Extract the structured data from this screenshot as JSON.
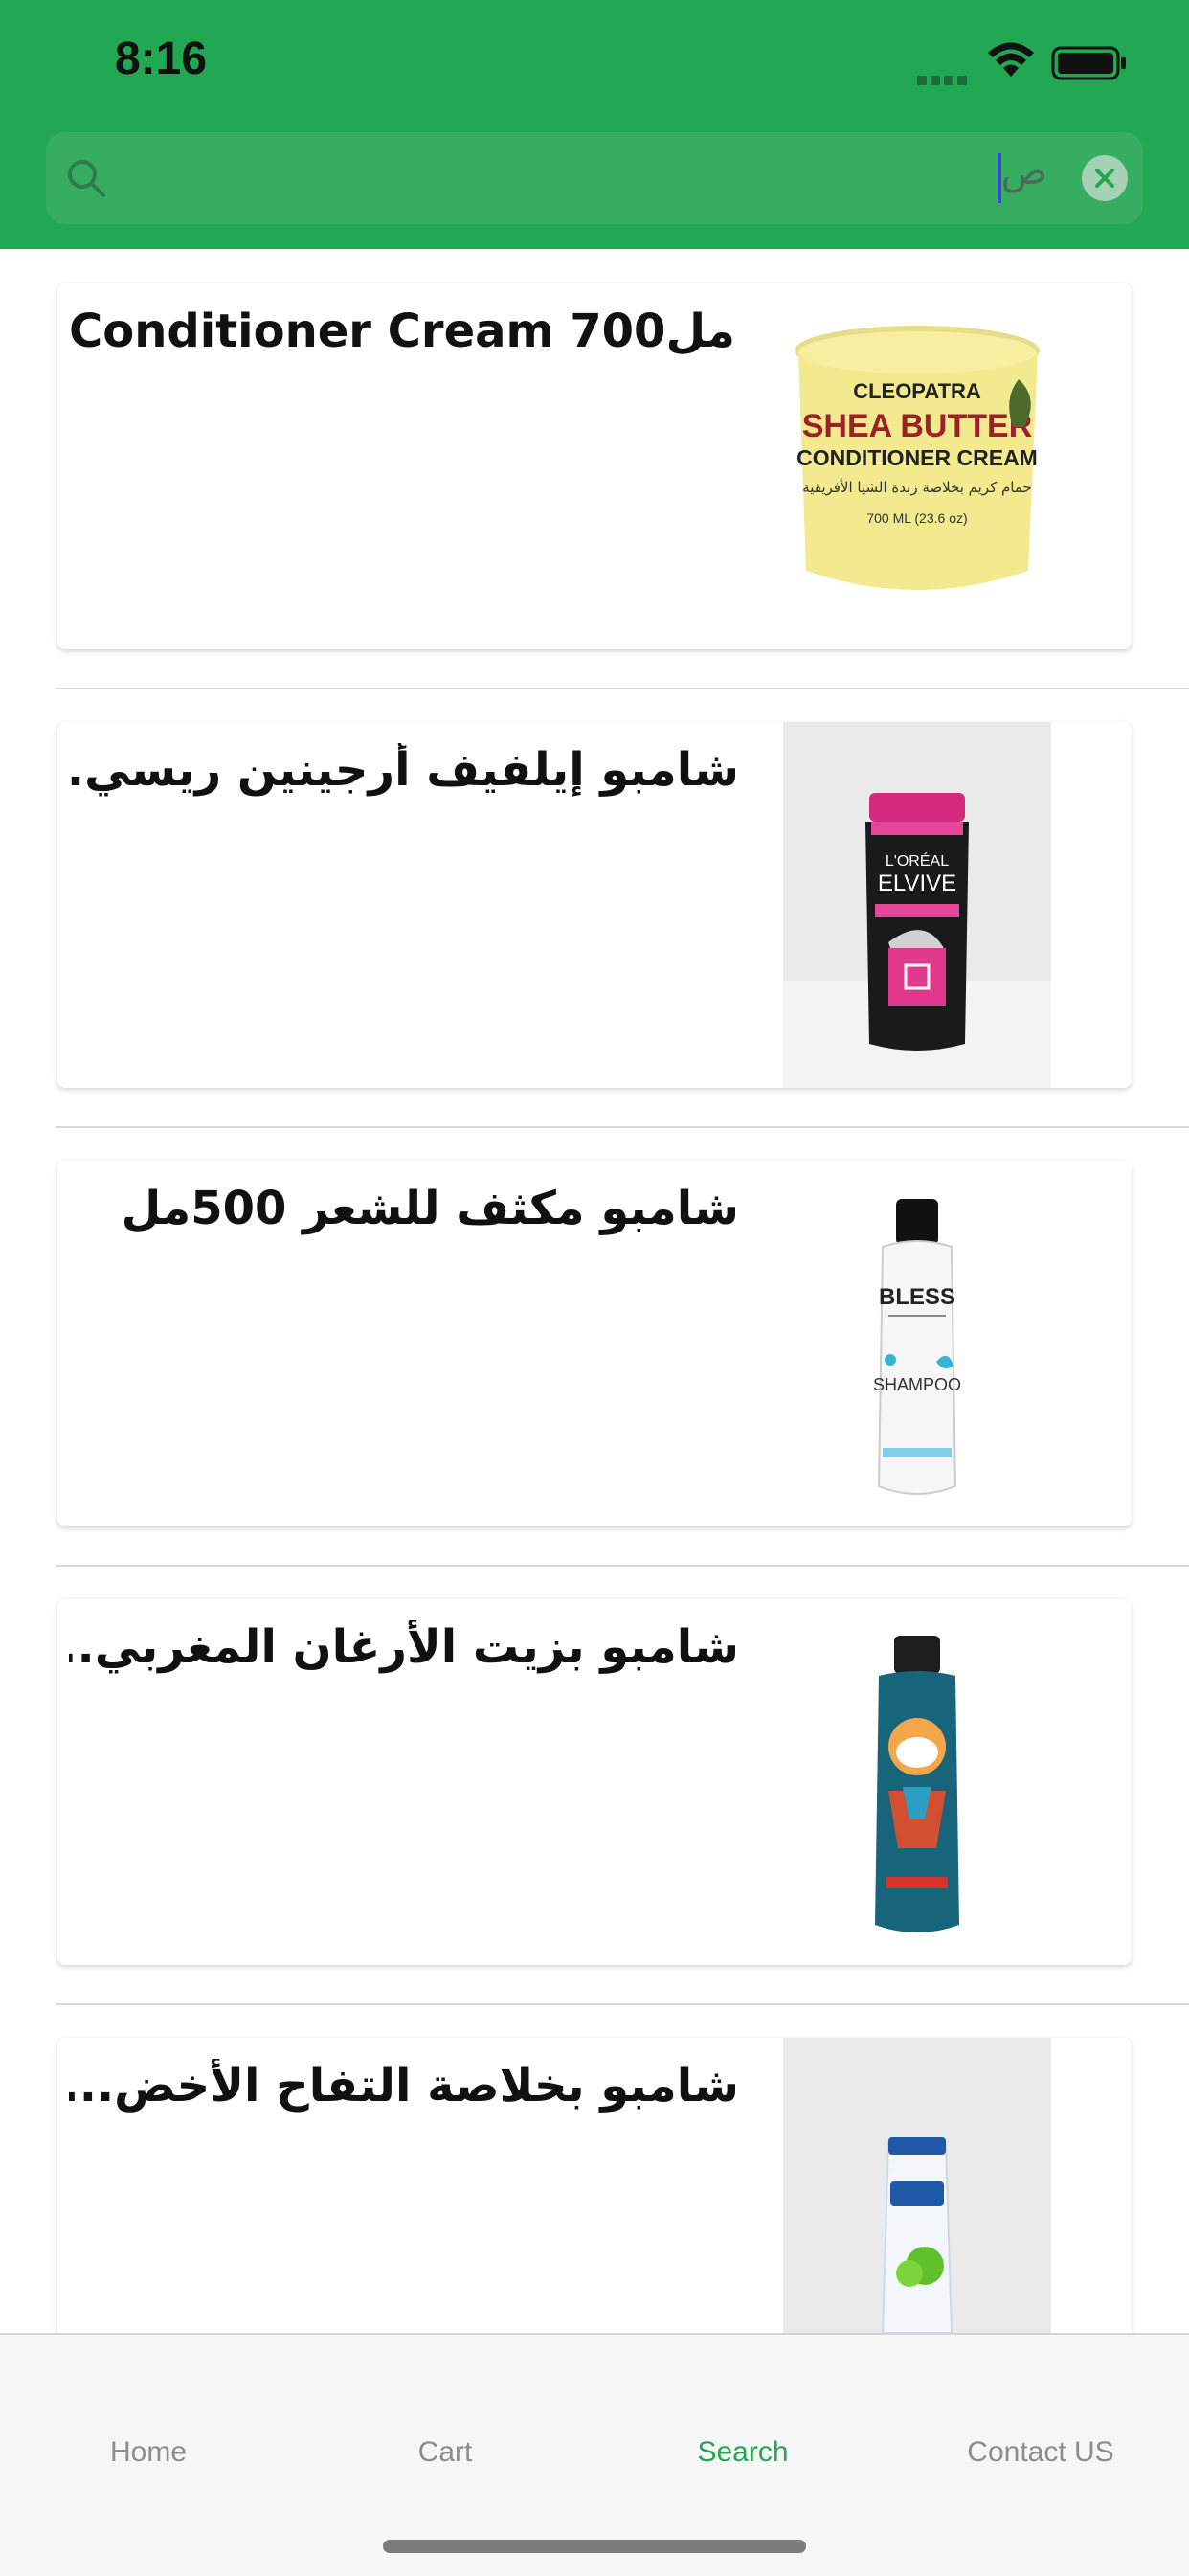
{
  "status": {
    "time": "8:16"
  },
  "search": {
    "query": "ص"
  },
  "products": [
    {
      "title": "Conditioner Cream 700مل",
      "image": "cleopatra-shea-butter-jar"
    },
    {
      "title": "شامبو إيلفيف أرجينين ريسي...",
      "image": "loreal-elvive-bottle"
    },
    {
      "title": "شامبو مكثف للشعر 500مل",
      "image": "bless-shampoo-bottle"
    },
    {
      "title": "شامبو بزيت الأرغان المغربي...",
      "image": "herbal-essences-argan-bottle"
    },
    {
      "title": "شامبو بخلاصة التفاح الأخض...",
      "image": "head-shoulders-apple-bottle"
    }
  ],
  "product_images_text": {
    "cleopatra": {
      "brand": "CLEOPATRA",
      "line1": "SHEA BUTTER",
      "line2": "CONDITIONER CREAM",
      "volume": "700 ML (23.6 oz)"
    },
    "elvive": {
      "brand": "L'ORÉAL",
      "name": "ELVIVE"
    },
    "bless": {
      "brand": "BLESS",
      "name": "SHAMPOO"
    }
  },
  "tabs": [
    {
      "label": "Home"
    },
    {
      "label": "Cart"
    },
    {
      "label": "Search",
      "active": true
    },
    {
      "label": "Contact US"
    }
  ],
  "colors": {
    "header": "#22a753",
    "accent": "#22a753"
  }
}
